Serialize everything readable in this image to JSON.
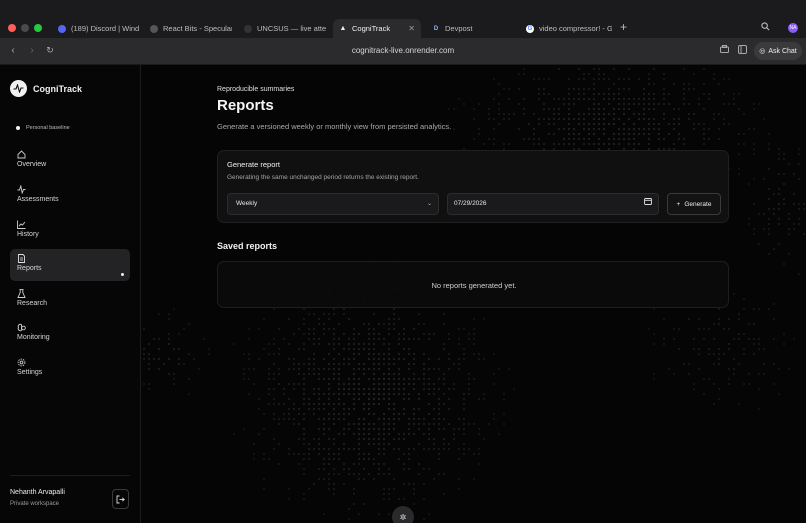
{
  "browser": {
    "tabs": [
      {
        "label": "(189) Discord | Wind F",
        "icon": "discord-icon",
        "color": "#5865f2"
      },
      {
        "label": "React Bits - Specular I",
        "icon": "react-bits-icon",
        "color": "#444"
      },
      {
        "label": "UNCSUS — live attend",
        "icon": "uncsus-icon",
        "color": "#333"
      },
      {
        "label": "CogniTrack",
        "icon": "cognitrack-icon",
        "color": "#eee",
        "active": true
      },
      {
        "label": "Devpost",
        "icon": "devpost-icon",
        "color": "#1b1b1d"
      },
      {
        "label": "video compressor! - G",
        "icon": "google-icon",
        "color": "#fff"
      }
    ],
    "url": "cognitrack-live.onrender.com",
    "ask_chat": "Ask Chat",
    "profile_initials": "NA"
  },
  "sidebar": {
    "brand": "CogniTrack",
    "baseline": "Personal baseline",
    "items": [
      {
        "label": "Overview",
        "icon": "home-icon"
      },
      {
        "label": "Assessments",
        "icon": "activity-icon"
      },
      {
        "label": "History",
        "icon": "chart-icon"
      },
      {
        "label": "Reports",
        "icon": "document-icon",
        "active": true
      },
      {
        "label": "Research",
        "icon": "flask-icon"
      },
      {
        "label": "Monitoring",
        "icon": "brain-icon"
      },
      {
        "label": "Settings",
        "icon": "gear-icon"
      }
    ],
    "user_name": "Nehanth Arvapalli",
    "workspace": "Private workspace"
  },
  "main": {
    "eyebrow": "Reproducible summaries",
    "title": "Reports",
    "subtitle": "Generate a versioned weekly or monthly view from persisted analytics.",
    "generate_card": {
      "title": "Generate report",
      "description": "Generating the same unchanged period returns the existing report.",
      "period": "Weekly",
      "date": "07/29/2026",
      "button": "Generate"
    },
    "saved_title": "Saved reports",
    "empty_text": "No reports generated yet."
  }
}
